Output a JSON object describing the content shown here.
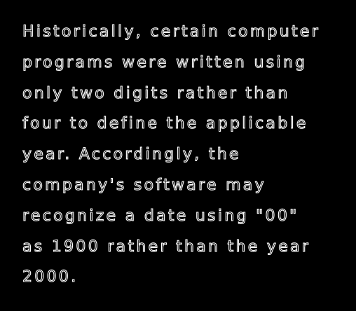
{
  "paragraph": {
    "lines": [
      "Historically, certain computer",
      "programs were written using",
      "only two digits rather than",
      "four to define the applicable",
      "year. Accordingly, the",
      "company's software may",
      "recognize a date using \"00\"",
      "as 1900 rather than the year",
      "2000."
    ]
  },
  "colors": {
    "background": "#000000",
    "text_outline": "#ffffff"
  }
}
